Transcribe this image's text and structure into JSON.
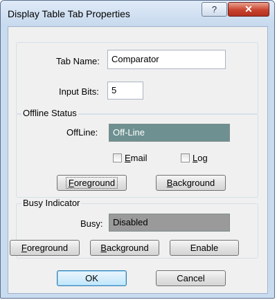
{
  "window": {
    "title": "Display Table Tab Properties",
    "help_label": "?",
    "close_label": "✕"
  },
  "tab": {
    "name_label": "Tab Name:",
    "name_value": "Comparator",
    "bits_label": "Input Bits:",
    "bits_value": "5"
  },
  "offline": {
    "group_label": "Offline Status",
    "status_label": "OffLine:",
    "status_value": "Off-Line",
    "status_bg": "#6e9090",
    "status_fg": "#ffffff",
    "email_label_first": "E",
    "email_label_rest": "mail",
    "email_checked": false,
    "log_label_first": "L",
    "log_label_rest": "og",
    "log_checked": false,
    "foreground_first": "F",
    "foreground_rest": "oreground",
    "background_first": "B",
    "background_rest": "ackground"
  },
  "busy": {
    "group_label": "Busy Indicator",
    "status_label": "Busy:",
    "status_value": "Disabled",
    "status_bg": "#9a9a9a",
    "status_fg": "#000000",
    "foreground_first": "F",
    "foreground_rest": "oreground",
    "background_first": "B",
    "background_rest": "ackground",
    "enable_label": "Enable"
  },
  "footer": {
    "ok_label": "OK",
    "cancel_label": "Cancel"
  }
}
